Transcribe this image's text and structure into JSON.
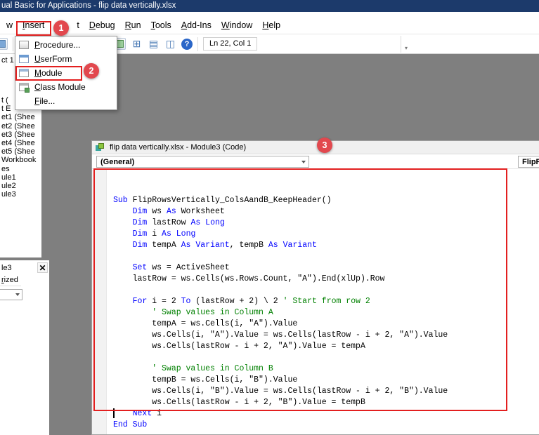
{
  "colors": {
    "titlebar": "#1c3a6b",
    "annotation": "#e31f1f",
    "badge": "#e2484e",
    "keyword": "#0000ff",
    "comment": "#008000",
    "mdi": "#7f7f7f"
  },
  "title_bar": {
    "title": "ual Basic for Applications - flip data vertically.xlsx"
  },
  "menu_bar": {
    "items": [
      {
        "label": "w",
        "accel": false,
        "gap": false
      },
      {
        "label": "Insert",
        "accel": true,
        "gap": false
      },
      {
        "label": "t",
        "accel": false,
        "gap": true
      },
      {
        "label": "Debug",
        "accel": true,
        "gap": false
      },
      {
        "label": "Run",
        "accel": true,
        "gap": false
      },
      {
        "label": "Tools",
        "accel": true,
        "gap": false
      },
      {
        "label": "Add-Ins",
        "accel": true,
        "gap": false
      },
      {
        "label": "Window",
        "accel": true,
        "gap": false
      },
      {
        "label": "Help",
        "accel": true,
        "gap": false
      }
    ]
  },
  "insert_menu": {
    "items": [
      {
        "label": "Procedure...",
        "icon": "procedure-icon"
      },
      {
        "label": "UserForm",
        "icon": "userform-icon"
      },
      {
        "label": "Module",
        "icon": "module-icon"
      },
      {
        "label": "Class Module",
        "icon": "class-module-icon"
      },
      {
        "label": "File...",
        "icon": null
      }
    ]
  },
  "toolbar": {
    "status": "Ln 22, Col 1"
  },
  "icons": {
    "run_icon": "▶",
    "break_icon": "Ⅱ",
    "reset_icon": "■",
    "project_explorer_icon": "⊞",
    "properties_window_icon": "▤",
    "object_browser_icon": "◫",
    "help_icon": "?",
    "overflow_chevron": "▾",
    "close_icon": "✕"
  },
  "annotations": {
    "badge1": "1",
    "badge2": "2",
    "badge3": "3"
  },
  "project_panel": {
    "caption_fragment": "ct 1",
    "items": [
      "t (",
      "t E",
      "et1 (Shee",
      "et2 (Shee",
      "et3 (Shee",
      "et4 (Shee",
      "et5 (Shee",
      "Workbook",
      "es",
      "ule1",
      "ule2",
      "ule3"
    ]
  },
  "properties_panel": {
    "title_fragment": "le3",
    "tab_fragment": "rized"
  },
  "code_window": {
    "title": "flip data vertically.xlsx - Module3 (Code)",
    "object_dropdown": "(General)",
    "procedure_dropdown_fragment": "FlipR"
  },
  "code": {
    "lines": [
      [
        [
          "k",
          "Sub"
        ],
        [
          "t",
          " FlipRowsVertically_ColsAandB_KeepHeader()"
        ]
      ],
      [
        [
          "t",
          "    "
        ],
        [
          "k",
          "Dim"
        ],
        [
          "t",
          " ws "
        ],
        [
          "k",
          "As"
        ],
        [
          "t",
          " Worksheet"
        ]
      ],
      [
        [
          "t",
          "    "
        ],
        [
          "k",
          "Dim"
        ],
        [
          "t",
          " lastRow "
        ],
        [
          "k",
          "As"
        ],
        [
          "t",
          " "
        ],
        [
          "k",
          "Long"
        ]
      ],
      [
        [
          "t",
          "    "
        ],
        [
          "k",
          "Dim"
        ],
        [
          "t",
          " i "
        ],
        [
          "k",
          "As"
        ],
        [
          "t",
          " "
        ],
        [
          "k",
          "Long"
        ]
      ],
      [
        [
          "t",
          "    "
        ],
        [
          "k",
          "Dim"
        ],
        [
          "t",
          " tempA "
        ],
        [
          "k",
          "As"
        ],
        [
          "t",
          " "
        ],
        [
          "k",
          "Variant"
        ],
        [
          "t",
          ", tempB "
        ],
        [
          "k",
          "As"
        ],
        [
          "t",
          " "
        ],
        [
          "k",
          "Variant"
        ]
      ],
      [],
      [
        [
          "t",
          "    "
        ],
        [
          "k",
          "Set"
        ],
        [
          "t",
          " ws = ActiveSheet"
        ]
      ],
      [
        [
          "t",
          "    lastRow = ws.Cells(ws.Rows.Count, \"A\").End(xlUp).Row"
        ]
      ],
      [],
      [
        [
          "t",
          "    "
        ],
        [
          "k",
          "For"
        ],
        [
          "t",
          " i = 2 "
        ],
        [
          "k",
          "To"
        ],
        [
          "t",
          " (lastRow + 2) \\ 2 "
        ],
        [
          "c",
          "' Start from row 2"
        ]
      ],
      [
        [
          "t",
          "        "
        ],
        [
          "c",
          "' Swap values in Column A"
        ]
      ],
      [
        [
          "t",
          "        tempA = ws.Cells(i, \"A\").Value"
        ]
      ],
      [
        [
          "t",
          "        ws.Cells(i, \"A\").Value = ws.Cells(lastRow - i + 2, \"A\").Value"
        ]
      ],
      [
        [
          "t",
          "        ws.Cells(lastRow - i + 2, \"A\").Value = tempA"
        ]
      ],
      [],
      [
        [
          "t",
          "        "
        ],
        [
          "c",
          "' Swap values in Column B"
        ]
      ],
      [
        [
          "t",
          "        tempB = ws.Cells(i, \"B\").Value"
        ]
      ],
      [
        [
          "t",
          "        ws.Cells(i, \"B\").Value = ws.Cells(lastRow - i + 2, \"B\").Value"
        ]
      ],
      [
        [
          "t",
          "        ws.Cells(lastRow - i + 2, \"B\").Value = tempB"
        ]
      ],
      [
        [
          "t",
          "    "
        ],
        [
          "k",
          "Next"
        ],
        [
          "t",
          " i"
        ]
      ],
      [
        [
          "k",
          "End Sub"
        ]
      ]
    ]
  }
}
